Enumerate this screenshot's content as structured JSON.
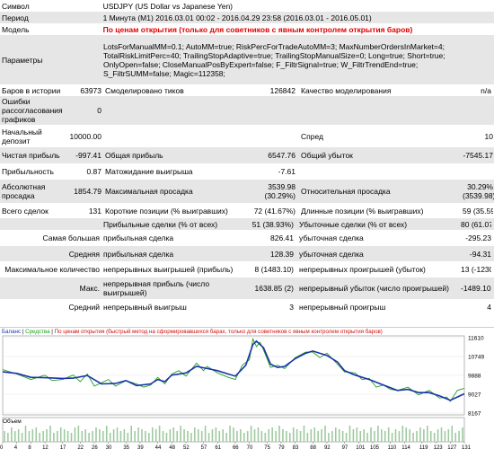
{
  "report": {
    "symbol_label": "Символ",
    "symbol_value": "USDJPY (US Dollar vs Japanese Yen)",
    "period_label": "Период",
    "period_value": "1 Минута (M1) 2016.03.01 00:02 - 2016.04.29 23:58 (2016.03.01 - 2016.05.01)",
    "model_label": "Модель",
    "model_value": "По ценам открытия (только для советников с явным контролем открытия баров)",
    "params_label": "Параметры",
    "params_value": "LotsForManualMM=0.1; AutoMM=true; RiskPercForTradeAutoMM=3; MaxNumberOrdersInMarket=4; TotalRiskLimitPerc=40; TrailingStopAdaptive=true; TrailingStopManualSize=0; Long=true; Short=true; OnlyOpen=false; CloseManualPosByExpert=false; F_FiltrSignal=true; W_FiltrTrendEnd=true; S_FiltrSUMM=false; Magic=112358;",
    "bars_label": "Баров в истории",
    "bars_value": "63973",
    "ticks_label": "Смоделировано тиков",
    "ticks_value": "126842",
    "quality_label": "Качество моделирования",
    "quality_value": "n/a",
    "errors_label": "Ошибки рассогласования графиков",
    "errors_value": "0",
    "deposit_label": "Начальный депозит",
    "deposit_value": "10000.00",
    "spread_label": "Спред",
    "spread_value": "10",
    "netprofit_label": "Чистая прибыль",
    "netprofit_value": "-997.41",
    "grossprofit_label": "Общая прибыль",
    "grossprofit_value": "6547.76",
    "grossloss_label": "Общий убыток",
    "grossloss_value": "-7545.17",
    "pf_label": "Прибыльность",
    "pf_value": "0.87",
    "expected_label": "Матожидание выигрыша",
    "expected_value": "-7.61",
    "absdd_label": "Абсолютная просадка",
    "absdd_value": "1854.79",
    "maxdd_label": "Максимальная просадка",
    "maxdd_value": "3539.98 (30.29%)",
    "reldd_label": "Относительная просадка",
    "reldd_value": "30.29% (3539.98)",
    "total_label": "Всего сделок",
    "total_value": "131",
    "short_label": "Короткие позиции (% выигравших)",
    "short_value": "72 (41.67%)",
    "long_label": "Длинные позиции (% выигравших)",
    "long_value": "59 (35.59%)",
    "profit_trades_label": "Прибыльные сделки (% от всех)",
    "profit_trades_value": "51 (38.93%)",
    "loss_trades_label": "Убыточные сделки (% от всех)",
    "loss_trades_value": "80 (61.07%)",
    "largest_label": "Самая большая",
    "largest_profit_label": "прибыльная сделка",
    "largest_profit_value": "826.41",
    "largest_loss_label": "убыточная сделка",
    "largest_loss_value": "-295.23",
    "average_label": "Средняя",
    "average_profit_label": "прибыльная сделка",
    "average_profit_value": "128.39",
    "average_loss_label": "убыточная сделка",
    "average_loss_value": "-94.31",
    "maxcount_label": "Максимальное количество",
    "maxcount_wins_label": "непрерывных выигрышей (прибыль)",
    "maxcount_wins_value": "8 (1483.10)",
    "maxcount_losses_label": "непрерывных проигрышей (убыток)",
    "maxcount_losses_value": "13 (-1230.47)",
    "max_label": "Макс.",
    "max_profit_label": "непрерывная прибыль (число выигрышей)",
    "max_profit_value": "1638.85 (2)",
    "max_loss_label": "непрерывный убыток (число проигрышей)",
    "max_loss_value": "-1489.10 (8)",
    "avg_label": "Средний",
    "avg_wins_label": "непрерывный выигрыш",
    "avg_wins_value": "3",
    "avg_losses_label": "непрерывный проигрыш",
    "avg_losses_value": "4"
  },
  "chart_legend": {
    "balance": "Баланс",
    "equity": "Средства",
    "model": "По ценам открытия (быстрый метод на сформировавшихся барах, только для советников с явным контролем открытия баров)"
  },
  "volume_label": "Объем",
  "colors": {
    "balance": "#1a33aa",
    "equity": "#20a020",
    "volume": "#9ec99e",
    "model_text": "#e00000",
    "row_shade": "#e6e6e6"
  },
  "chart_data": {
    "type": "line",
    "y_ticks": [
      "11610",
      "10749",
      "9888",
      "9027",
      "8167"
    ],
    "x_ticks": [
      "0",
      "4",
      "8",
      "12",
      "17",
      "22",
      "26",
      "30",
      "35",
      "39",
      "44",
      "48",
      "52",
      "57",
      "61",
      "66",
      "70",
      "75",
      "79",
      "83",
      "88",
      "92",
      "97",
      "101",
      "105",
      "110",
      "114",
      "119",
      "123",
      "127",
      "131"
    ],
    "ylim": [
      8167,
      11610
    ],
    "xlim": [
      0,
      131
    ],
    "series": [
      {
        "name": "Баланс",
        "x": [
          0,
          4,
          8,
          12,
          17,
          20,
          24,
          28,
          32,
          35,
          38,
          42,
          44,
          46,
          48,
          52,
          55,
          58,
          61,
          64,
          66,
          69,
          71,
          72,
          74,
          76,
          78,
          80,
          83,
          86,
          88,
          92,
          95,
          97,
          100,
          104,
          108,
          112,
          115,
          118,
          121,
          124,
          127,
          129,
          131
        ],
        "values": [
          10050,
          9980,
          9800,
          9780,
          9750,
          9760,
          9880,
          9500,
          9520,
          9650,
          9420,
          9500,
          9700,
          9600,
          9900,
          10000,
          10300,
          10200,
          10100,
          9950,
          9850,
          10350,
          11300,
          11450,
          11150,
          10400,
          10250,
          10300,
          10650,
          10900,
          11000,
          10800,
          10500,
          10100,
          9900,
          9700,
          9450,
          9200,
          9250,
          9100,
          9100,
          8950,
          8750,
          8900,
          9050
        ]
      },
      {
        "name": "Средства",
        "x": [
          0,
          4,
          8,
          12,
          14,
          17,
          20,
          22,
          24,
          26,
          28,
          30,
          32,
          35,
          38,
          40,
          42,
          44,
          46,
          48,
          50,
          52,
          55,
          57,
          58,
          61,
          64,
          66,
          68,
          70,
          71,
          72,
          73,
          74,
          76,
          78,
          80,
          83,
          86,
          88,
          90,
          92,
          95,
          97,
          100,
          102,
          104,
          106,
          108,
          110,
          112,
          115,
          118,
          121,
          124,
          126,
          127,
          129,
          131
        ],
        "values": [
          10150,
          9950,
          9700,
          9900,
          9650,
          9700,
          9900,
          9600,
          9950,
          9400,
          9550,
          9700,
          9400,
          9650,
          9500,
          9350,
          9450,
          9800,
          9500,
          9950,
          10100,
          9850,
          10450,
          10100,
          10300,
          10000,
          9800,
          9700,
          10350,
          10600,
          11550,
          11200,
          11400,
          11050,
          10250,
          10350,
          10200,
          10700,
          10950,
          10950,
          10700,
          10900,
          10400,
          10050,
          10000,
          9700,
          9750,
          9350,
          9450,
          9250,
          9200,
          9350,
          9000,
          9200,
          8850,
          8900,
          8700,
          9200,
          9300
        ]
      }
    ],
    "volume": [
      0.6,
      0.5,
      0.8,
      0.6,
      0.7,
      0.5,
      0.9,
      0.6,
      0.7,
      0.8,
      0.5,
      0.6,
      0.7,
      0.9,
      0.5,
      0.6,
      0.8,
      0.7,
      0.6,
      0.5,
      0.8,
      0.9,
      0.6,
      0.7,
      0.5,
      0.6,
      0.8,
      0.7,
      0.6,
      0.9,
      0.5,
      0.7,
      0.8,
      0.6,
      0.7,
      0.5,
      0.9,
      0.6,
      0.8,
      0.7,
      0.6,
      0.5,
      0.8,
      0.7,
      0.9,
      0.6,
      0.5,
      0.7,
      0.8,
      0.6,
      0.9,
      0.7,
      0.6,
      0.5,
      0.8,
      0.7,
      0.6,
      0.9,
      0.5,
      0.7,
      0.8,
      0.6,
      0.7,
      0.5,
      0.9,
      0.8,
      0.6,
      0.7,
      0.5,
      0.6,
      0.9,
      0.7,
      0.8,
      0.6,
      0.5,
      0.7,
      0.8,
      0.6,
      0.9,
      0.7,
      0.6,
      0.5,
      0.8,
      0.7,
      0.6,
      0.9,
      0.5,
      0.7,
      0.8,
      0.6,
      0.7,
      0.9,
      0.5,
      0.6,
      0.8,
      0.7,
      0.6,
      0.5,
      0.9,
      0.7,
      0.8,
      0.6,
      0.7,
      0.5,
      0.8,
      0.6,
      0.9,
      0.7,
      0.6,
      0.8,
      0.5,
      0.7,
      0.6,
      0.9,
      0.8,
      0.7,
      0.5,
      0.6,
      0.8,
      0.7,
      0.9,
      0.6,
      0.5,
      0.7,
      0.8,
      0.6,
      0.7,
      0.9,
      0.5,
      0.6,
      0.8
    ]
  }
}
